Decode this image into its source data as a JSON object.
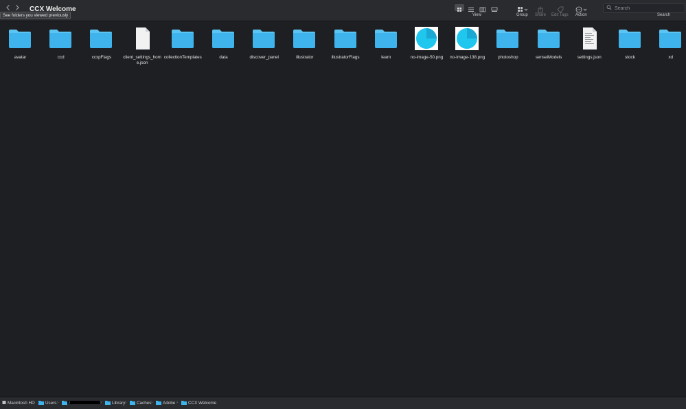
{
  "window": {
    "title": "CCX Welcome",
    "tooltip": "See folders you viewed previously"
  },
  "toolbar": {
    "view_label": "View",
    "group_label": "Group",
    "share_label": "Share",
    "edit_tags_label": "Edit Tags",
    "action_label": "Action",
    "search_label": "Search",
    "search_placeholder": "Search"
  },
  "items": [
    {
      "name": "avatar",
      "kind": "folder"
    },
    {
      "name": "ccd",
      "kind": "folder"
    },
    {
      "name": "ccxpFlags",
      "kind": "folder"
    },
    {
      "name": "client_settings_home.json",
      "kind": "file"
    },
    {
      "name": "collectionTemplates",
      "kind": "folder"
    },
    {
      "name": "data",
      "kind": "folder"
    },
    {
      "name": "discover_panel",
      "kind": "folder"
    },
    {
      "name": "illustrator",
      "kind": "folder"
    },
    {
      "name": "illustratorFlags",
      "kind": "folder"
    },
    {
      "name": "learn",
      "kind": "folder"
    },
    {
      "name": "no-image-50.png",
      "kind": "image"
    },
    {
      "name": "no-image-138.png",
      "kind": "image"
    },
    {
      "name": "photoshop",
      "kind": "folder"
    },
    {
      "name": "senseiModels",
      "kind": "folder"
    },
    {
      "name": "settings.json",
      "kind": "json"
    },
    {
      "name": "stock",
      "kind": "folder"
    },
    {
      "name": "xd",
      "kind": "folder"
    }
  ],
  "pathbar": [
    {
      "label": "Macintosh HD",
      "icon": "disk-icon"
    },
    {
      "label": "Users",
      "icon": "folder-icon"
    },
    {
      "label": "r",
      "icon": "folder-icon"
    },
    {
      "label": "Library",
      "icon": "folder-icon"
    },
    {
      "label": "Caches",
      "icon": "folder-icon"
    },
    {
      "label": "Adobe",
      "icon": "folder-icon"
    },
    {
      "label": "CCX Welcome",
      "icon": "folder-icon"
    }
  ],
  "colors": {
    "folder": "#3fb3ec",
    "folder_tab": "#5cc4f2",
    "image_accent": "#1fc7ee"
  }
}
